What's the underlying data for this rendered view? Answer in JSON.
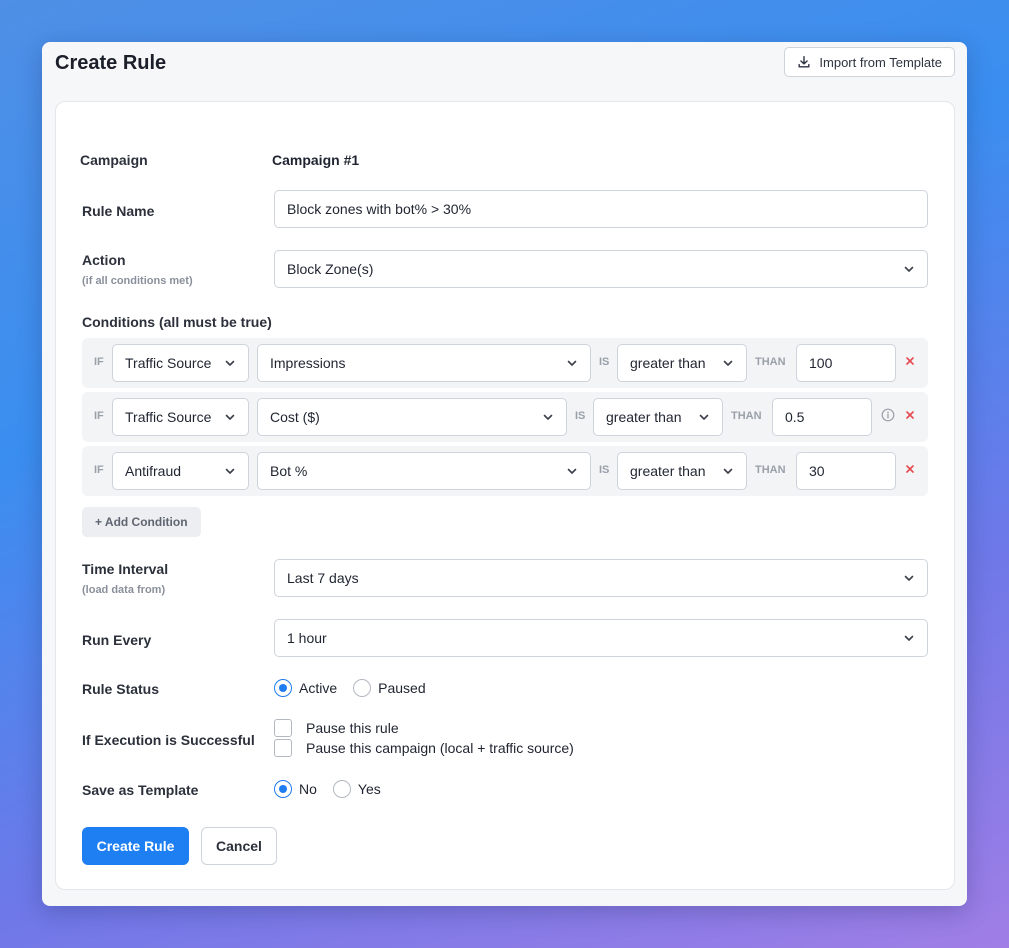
{
  "header": {
    "title": "Create Rule",
    "import_label": "Import from Template"
  },
  "campaign": {
    "label": "Campaign",
    "value": "Campaign #1"
  },
  "rule_name": {
    "label": "Rule Name",
    "value": "Block zones with bot% > 30%"
  },
  "action": {
    "label": "Action",
    "sublabel": "(if all conditions met)",
    "value": "Block Zone(s)"
  },
  "conditions": {
    "label": "Conditions (all must be true)",
    "kw_if": "IF",
    "kw_is": "IS",
    "kw_than": "THAN",
    "rows": [
      {
        "source": "Traffic Source",
        "metric": "Impressions",
        "operator": "greater than",
        "value": "100"
      },
      {
        "source": "Traffic Source",
        "metric": "Cost ($)",
        "operator": "greater than",
        "value": "0.5"
      },
      {
        "source": "Antifraud",
        "metric": "Bot %",
        "operator": "greater than",
        "value": "30"
      }
    ],
    "add_label": "+ Add Condition"
  },
  "time_interval": {
    "label": "Time Interval",
    "sublabel": "(load data from)",
    "value": "Last 7 days"
  },
  "run_every": {
    "label": "Run Every",
    "value": "1 hour"
  },
  "rule_status": {
    "label": "Rule Status",
    "options": [
      "Active",
      "Paused"
    ],
    "selected": "Active"
  },
  "on_success": {
    "label": "If Execution is Successful",
    "options": [
      "Pause this rule",
      "Pause this campaign (local + traffic source)"
    ]
  },
  "save_template": {
    "label": "Save as Template",
    "options": [
      "No",
      "Yes"
    ],
    "selected": "No"
  },
  "buttons": {
    "create": "Create Rule",
    "cancel": "Cancel"
  },
  "colors": {
    "accent": "#1e7ff2",
    "danger": "#e5484d"
  }
}
